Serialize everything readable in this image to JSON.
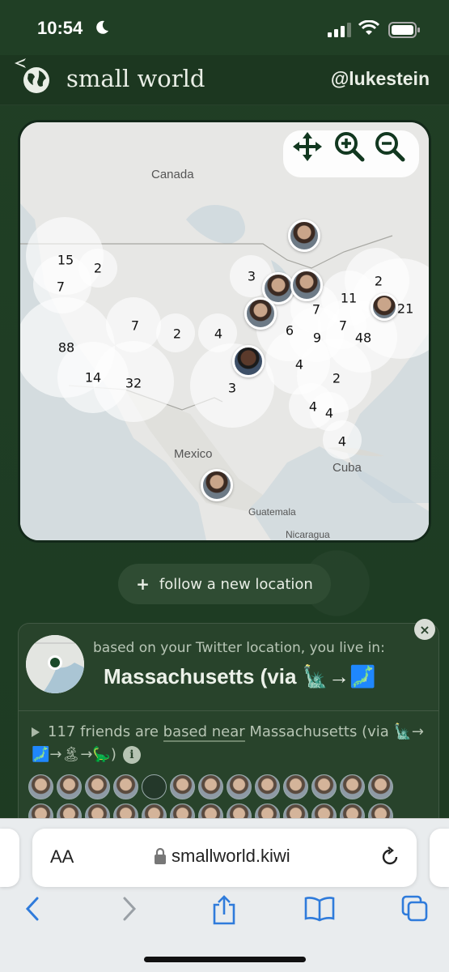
{
  "status_bar": {
    "time": "10:54"
  },
  "header": {
    "title": "small world",
    "username": "@lukestein"
  },
  "map": {
    "labels": {
      "canada": "Canada",
      "mexico": "Mexico",
      "cuba": "Cuba",
      "guatemala": "Guatemala",
      "nicaragua": "Nicaragua"
    },
    "clusters": [
      {
        "count": "15"
      },
      {
        "count": "2"
      },
      {
        "count": "7"
      },
      {
        "count": "88"
      },
      {
        "count": "14"
      },
      {
        "count": "32"
      },
      {
        "count": "7"
      },
      {
        "count": "2"
      },
      {
        "count": "4"
      },
      {
        "count": "3"
      },
      {
        "count": "3"
      },
      {
        "count": "6"
      },
      {
        "count": "7"
      },
      {
        "count": "9"
      },
      {
        "count": "4"
      },
      {
        "count": "11"
      },
      {
        "count": "7"
      },
      {
        "count": "48"
      },
      {
        "count": "2"
      },
      {
        "count": "121"
      },
      {
        "count": "2"
      },
      {
        "count": "4"
      },
      {
        "count": "4"
      },
      {
        "count": "4"
      }
    ]
  },
  "follow_button": {
    "label": "follow a new location"
  },
  "location_card": {
    "caption": "based on your Twitter location, you live in:",
    "location": "Massachusetts (via 🗽→🗾",
    "friends_prefix": "117 friends are ",
    "friends_link": "based near",
    "friends_suffix": " Massachusetts (via 🗽→🗾→🏝→🦕)",
    "info": "i"
  },
  "browser": {
    "aa": "AA",
    "url": "smallworld.kiwi"
  }
}
